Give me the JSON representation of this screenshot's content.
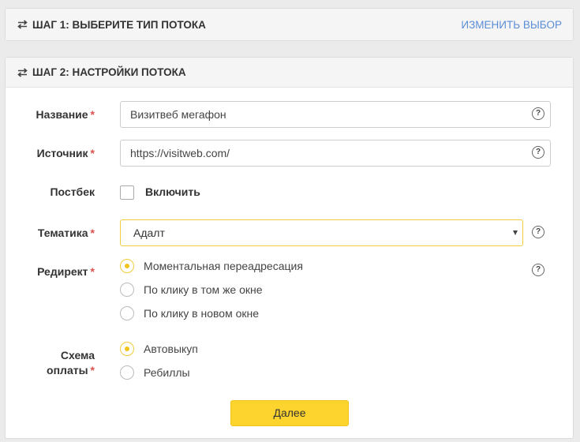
{
  "step1": {
    "title": "ШАГ 1: ВЫБЕРИТЕ ТИП ПОТОКА",
    "change_link": "ИЗМЕНИТЬ ВЫБОР"
  },
  "step2": {
    "title": "ШАГ 2: НАСТРОЙКИ ПОТОКА",
    "required_mark": "*",
    "help_glyph": "?",
    "name": {
      "label": "Название",
      "value": "Визитвеб мегафон"
    },
    "source": {
      "label": "Источник",
      "value": "https://visitweb.com/"
    },
    "postback": {
      "label": "Постбек",
      "checkbox_label": "Включить",
      "checked": false
    },
    "topic": {
      "label": "Тематика",
      "selected": "Адалт"
    },
    "redirect": {
      "label": "Редирект",
      "options": [
        "Моментальная переадресация",
        "По клику в том же окне",
        "По клику в новом окне"
      ],
      "selected_index": 0
    },
    "payment": {
      "label_line1": "Схема",
      "label_line2": "оплаты",
      "options": [
        "Автовыкуп",
        "Ребиллы"
      ],
      "selected_index": 0
    },
    "next_button": "Далее"
  },
  "colors": {
    "accent": "#fdd32e",
    "link": "#5b8dd6",
    "required": "#d9534f"
  }
}
